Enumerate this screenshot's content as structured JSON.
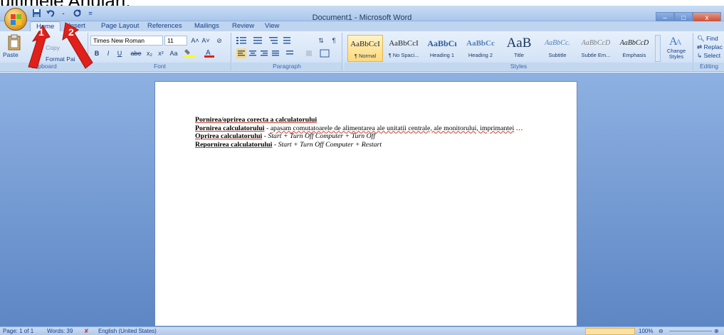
{
  "caption": "ultimele Anulari.",
  "window": {
    "title": "Document1 - Microsoft Word"
  },
  "window_buttons": {
    "minimize": "–",
    "maximize": "□",
    "close": "x"
  },
  "qat": {
    "save_icon": "save-icon",
    "undo_icon": "undo-icon",
    "redo_icon": "redo-icon"
  },
  "tabs": [
    {
      "label": "Home"
    },
    {
      "label": "Insert"
    },
    {
      "label": "Page Layout"
    },
    {
      "label": "References"
    },
    {
      "label": "Mailings"
    },
    {
      "label": "Review"
    },
    {
      "label": "View"
    }
  ],
  "clipboard": {
    "paste": "Paste",
    "copy": "Copy",
    "format_painter": "Format Pai",
    "group": "Clipboard"
  },
  "font": {
    "family": "Times New Roman",
    "size": "11",
    "group": "Font",
    "bold": "B",
    "italic": "I",
    "underline": "U",
    "strike": "abe",
    "subscript": "x₂",
    "superscript": "x²",
    "change_case": "Aa",
    "grow": "A˄",
    "shrink": "A˅",
    "clear": "⊘"
  },
  "paragraph": {
    "group": "Paragraph",
    "pilcrow": "¶",
    "sort": "⇅"
  },
  "styles": {
    "group": "Styles",
    "items": [
      {
        "sample": "AaBbCcI",
        "name": "¶ Normal"
      },
      {
        "sample": "AaBbCcI",
        "name": "¶ No Spaci..."
      },
      {
        "sample": "AaBbCı",
        "name": "Heading 1"
      },
      {
        "sample": "AaBbCc",
        "name": "Heading 2"
      },
      {
        "sample": "AaB",
        "name": "Title"
      },
      {
        "sample": "AaBbCc.",
        "name": "Subtitle"
      },
      {
        "sample": "AaBbCcD",
        "name": "Subtle Em..."
      },
      {
        "sample": "AaBbCcD",
        "name": "Emphasis"
      }
    ],
    "change_styles": "Change Styles"
  },
  "editing": {
    "group": "Editing",
    "find": "Find",
    "replace": "Replac",
    "select": "Select"
  },
  "annotations": {
    "arrow1": "1",
    "arrow2": "2"
  },
  "document": {
    "heading": "Pornirea/oprirea corecta a calculatorului",
    "line1_bold": "Pornirea calculatorului",
    "line1_rest_pre": " -  ",
    "line1_rest": "apasam comutatoarele de alimentarea ale unitatii centrale, ale monitorului, imprimantei",
    "line1_tail": " …",
    "line2_bold": "Oprirea calculatorului",
    "line2_sep": " - ",
    "line2_rest": "Start + Turn Off Computer + Turn Off",
    "line3_bold": "Repornirea calculatorului",
    "line3_sep": " - ",
    "line3_rest": "Start + Turn Off Computer + Restart"
  },
  "status": {
    "page": "Page: 1 of 1",
    "words": "Words: 39",
    "language": "English (United States)",
    "zoom": "100%"
  },
  "colors": {
    "ribbon": "#dbe8f8",
    "doc_background": "#6f96d2",
    "arrow_red": "#e0201b"
  }
}
